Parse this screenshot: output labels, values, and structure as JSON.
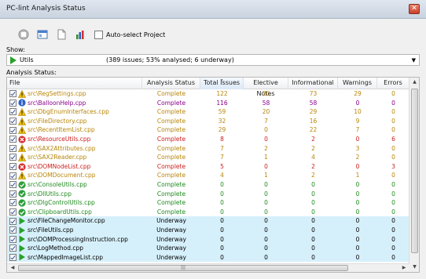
{
  "window": {
    "title": "PC-lint Analysis Status"
  },
  "toolbar": {
    "auto_select_label": "Auto-select Project"
  },
  "show": {
    "label": "Show:",
    "project_name": "Utils",
    "summary": "(389 issues; 53% analysed; 6 underway)"
  },
  "analysis": {
    "label": "Analysis Status:"
  },
  "columns": [
    "File",
    "Analysis Status",
    "Total Issues",
    "Elective Notes",
    "Informational",
    "Warnings",
    "Errors"
  ],
  "colors": {
    "complete": "#b8860b",
    "underway_bg": "#d6f0fb"
  },
  "rows": [
    {
      "file": "src\\RegSettings.cpp",
      "status": "Complete",
      "total": "122",
      "elective": "20",
      "info": "73",
      "warn": "29",
      "err": "0",
      "icon": "warning-icon",
      "tone": "orange",
      "numtone": "orange",
      "underway": false
    },
    {
      "file": "src\\BalloonHelp.cpp",
      "status": "Complete",
      "total": "116",
      "elective": "58",
      "info": "58",
      "warn": "0",
      "err": "0",
      "icon": "info-icon",
      "tone": "purple",
      "numtone": "purple",
      "underway": false
    },
    {
      "file": "src\\DbgEnumInterfaces.cpp",
      "status": "Complete",
      "total": "59",
      "elective": "20",
      "info": "29",
      "warn": "10",
      "err": "0",
      "icon": "warning-icon",
      "tone": "orange",
      "numtone": "orange",
      "underway": false
    },
    {
      "file": "src\\FileDirectory.cpp",
      "status": "Complete",
      "total": "32",
      "elective": "7",
      "info": "16",
      "warn": "9",
      "err": "0",
      "icon": "warning-icon",
      "tone": "orange",
      "numtone": "orange",
      "underway": false
    },
    {
      "file": "src\\RecentItemList.cpp",
      "status": "Complete",
      "total": "29",
      "elective": "0",
      "info": "22",
      "warn": "7",
      "err": "0",
      "icon": "warning-icon",
      "tone": "orange",
      "numtone": "orange",
      "underway": false
    },
    {
      "file": "src\\ResourceUtils.cpp",
      "status": "Complete",
      "total": "8",
      "elective": "0",
      "info": "2",
      "warn": "0",
      "err": "6",
      "icon": "error-icon",
      "tone": "red",
      "numtone": "red",
      "underway": false
    },
    {
      "file": "src\\SAX2Attributes.cpp",
      "status": "Complete",
      "total": "7",
      "elective": "2",
      "info": "2",
      "warn": "3",
      "err": "0",
      "icon": "warning-icon",
      "tone": "orange",
      "numtone": "orange",
      "underway": false
    },
    {
      "file": "src\\SAX2Reader.cpp",
      "status": "Complete",
      "total": "7",
      "elective": "1",
      "info": "4",
      "warn": "2",
      "err": "0",
      "icon": "warning-icon",
      "tone": "orange",
      "numtone": "orange",
      "underway": false
    },
    {
      "file": "src\\DOMNodeList.cpp",
      "status": "Complete",
      "total": "5",
      "elective": "0",
      "info": "2",
      "warn": "0",
      "err": "3",
      "icon": "error-icon",
      "tone": "red",
      "numtone": "red",
      "underway": false
    },
    {
      "file": "src\\DOMDocument.cpp",
      "status": "Complete",
      "total": "4",
      "elective": "1",
      "info": "2",
      "warn": "1",
      "err": "0",
      "icon": "warning-icon",
      "tone": "orange",
      "numtone": "orange",
      "underway": false
    },
    {
      "file": "src\\ConsoleUtils.cpp",
      "status": "Complete",
      "total": "0",
      "elective": "0",
      "info": "0",
      "warn": "0",
      "err": "0",
      "icon": "ok-icon",
      "tone": "green",
      "numtone": "green",
      "underway": false
    },
    {
      "file": "src\\DllUtils.cpp",
      "status": "Complete",
      "total": "0",
      "elective": "0",
      "info": "0",
      "warn": "0",
      "err": "0",
      "icon": "ok-icon",
      "tone": "green",
      "numtone": "green",
      "underway": false
    },
    {
      "file": "src\\DlgControlUtils.cpp",
      "status": "Complete",
      "total": "0",
      "elective": "0",
      "info": "0",
      "warn": "0",
      "err": "0",
      "icon": "ok-icon",
      "tone": "green",
      "numtone": "green",
      "underway": false
    },
    {
      "file": "src\\ClipboardUtils.cpp",
      "status": "Complete",
      "total": "0",
      "elective": "0",
      "info": "0",
      "warn": "0",
      "err": "0",
      "icon": "ok-icon",
      "tone": "green",
      "numtone": "green",
      "underway": false
    },
    {
      "file": "src\\FileChangeMonitor.cpp",
      "status": "Underway",
      "total": "0",
      "elective": "0",
      "info": "0",
      "warn": "0",
      "err": "0",
      "icon": "play-icon",
      "tone": "black",
      "numtone": "black",
      "underway": true
    },
    {
      "file": "src\\FileUtils.cpp",
      "status": "Underway",
      "total": "0",
      "elective": "0",
      "info": "0",
      "warn": "0",
      "err": "0",
      "icon": "play-icon",
      "tone": "black",
      "numtone": "black",
      "underway": true
    },
    {
      "file": "src\\DOMProcessingInstruction.cpp",
      "status": "Underway",
      "total": "0",
      "elective": "0",
      "info": "0",
      "warn": "0",
      "err": "0",
      "icon": "play-icon",
      "tone": "black",
      "numtone": "black",
      "underway": true
    },
    {
      "file": "src\\LogMethod.cpp",
      "status": "Underway",
      "total": "0",
      "elective": "0",
      "info": "0",
      "warn": "0",
      "err": "0",
      "icon": "play-icon",
      "tone": "black",
      "numtone": "black",
      "underway": true
    },
    {
      "file": "src\\MappedImageList.cpp",
      "status": "Underway",
      "total": "0",
      "elective": "0",
      "info": "0",
      "warn": "0",
      "err": "0",
      "icon": "play-icon",
      "tone": "black",
      "numtone": "black",
      "underway": true
    }
  ]
}
